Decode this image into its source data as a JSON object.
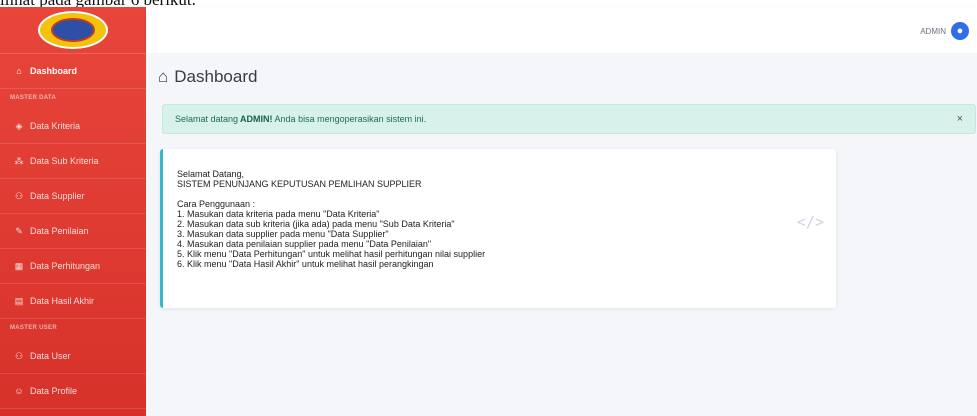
{
  "doc_caption": "ilihat pada gambar 6 berikut.",
  "sidebar": {
    "items": [
      {
        "label": "Dashboard",
        "icon": "home-icon",
        "active": true
      },
      {
        "heading": "MASTER DATA"
      },
      {
        "label": "Data Kriteria",
        "icon": "cube-icon"
      },
      {
        "label": "Data Sub Kriteria",
        "icon": "cubes-icon"
      },
      {
        "label": "Data Supplier",
        "icon": "users-icon"
      },
      {
        "label": "Data Penilaian",
        "icon": "edit-icon"
      },
      {
        "label": "Data Perhitungan",
        "icon": "calculator-icon"
      },
      {
        "label": "Data Hasil Akhir",
        "icon": "chart-icon"
      },
      {
        "heading": "MASTER USER"
      },
      {
        "label": "Data User",
        "icon": "user-group-icon"
      },
      {
        "label": "Data Profile",
        "icon": "user-icon"
      }
    ]
  },
  "topbar": {
    "user_label": "ADMIN"
  },
  "main": {
    "title": "Dashboard",
    "alert": {
      "prefix": "Selamat datang",
      "user": "ADMIN!",
      "suffix": "Anda bisa mengoperasikan sistem ini.",
      "close": "×"
    },
    "card": {
      "greeting": "Selamat Datang,",
      "system_name": "SISTEM PENUNJANG KEPUTUSAN PEMLIHAN SUPPLIER",
      "usage_title": "Cara Penggunaan :",
      "steps": [
        "1. Masukan data kriteria pada menu \"Data Kriteria\"",
        "2. Masukan data sub kriteria (jika ada) pada menu \"Sub Data Kriteria\"",
        "3. Masukan data supplier pada menu \"Data Supplier\"",
        "4. Masukan data penilaian supplier pada menu \"Data Penilaian\"",
        "5. Klik menu \"Data Perhitungan\" untuk melihat hasil perhitungan nilai supplier",
        "6. Klik menu \"Data Hasil Akhir\" untuk melihat hasil perangkingan"
      ],
      "icon": "code-icon"
    }
  },
  "colors": {
    "sidebar": "#e23f35",
    "accent": "#36b9cc",
    "alert_bg": "#d8f1ea"
  }
}
